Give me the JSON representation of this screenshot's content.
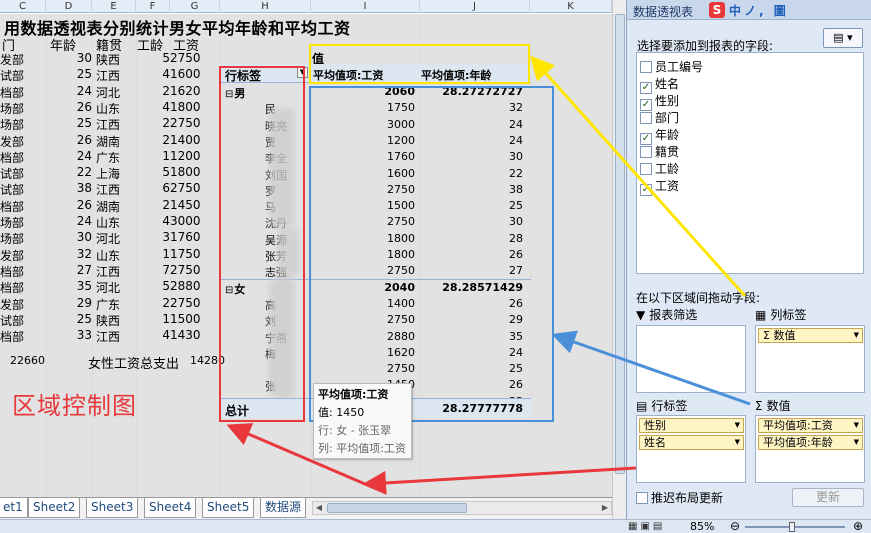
{
  "sheet": {
    "columns": [
      "C",
      "D",
      "E",
      "F",
      "G",
      "H",
      "I",
      "J",
      "K"
    ],
    "title": "用数据透视表分别统计男女平均年龄和平均工资",
    "headers": [
      "门",
      "年龄",
      "籍贯",
      "工龄",
      "工资"
    ],
    "rows": [
      [
        "发部",
        "30",
        "陕西",
        "5",
        "2750"
      ],
      [
        "试部",
        "25",
        "江西",
        "4",
        "1600"
      ],
      [
        "档部",
        "24",
        "河北",
        "2",
        "1620"
      ],
      [
        "场部",
        "26",
        "山东",
        "4",
        "1800"
      ],
      [
        "场部",
        "25",
        "江西",
        "2",
        "2750"
      ],
      [
        "发部",
        "26",
        "湖南",
        "2",
        "1400"
      ],
      [
        "档部",
        "24",
        "广东",
        "1",
        "1200"
      ],
      [
        "试部",
        "22",
        "上海",
        "5",
        "1800"
      ],
      [
        "试部",
        "38",
        "江西",
        "6",
        "2750"
      ],
      [
        "档部",
        "26",
        "湖南",
        "2",
        "1450"
      ],
      [
        "场部",
        "24",
        "山东",
        "4",
        "3000"
      ],
      [
        "场部",
        "30",
        "河北",
        "3",
        "1760"
      ],
      [
        "发部",
        "32",
        "山东",
        "1",
        "1750"
      ],
      [
        "档部",
        "27",
        "江西",
        "7",
        "2750"
      ],
      [
        "档部",
        "35",
        "河北",
        "5",
        "2880"
      ],
      [
        "发部",
        "29",
        "广东",
        "2",
        "2750"
      ],
      [
        "试部",
        "25",
        "陕西",
        "1",
        "1500"
      ],
      [
        "档部",
        "33",
        "江西",
        "4",
        "1430"
      ]
    ],
    "sum_value": "22660",
    "sum_label": "女性工资总支出",
    "sum_value2": "14280",
    "region_label": "区域控制图"
  },
  "pivot": {
    "values_header": "值",
    "row_label": "行标签",
    "col1_header": "平均值项:工资",
    "col2_header": "平均值项:年龄",
    "male": {
      "label": "男",
      "salary": "2060",
      "age": "28.27272727",
      "items": [
        {
          "name": "民",
          "salary": "1750",
          "age": "32"
        },
        {
          "name": "晓亮",
          "salary": "3000",
          "age": "24"
        },
        {
          "name": "贾",
          "salary": "1200",
          "age": "24"
        },
        {
          "name": "李全",
          "salary": "1760",
          "age": "30"
        },
        {
          "name": "刘国",
          "salary": "1600",
          "age": "22"
        },
        {
          "name": "罗",
          "salary": "2750",
          "age": "38"
        },
        {
          "name": "马",
          "salary": "1500",
          "age": "25"
        },
        {
          "name": "沈丹",
          "salary": "2750",
          "age": "30"
        },
        {
          "name": "吴源",
          "salary": "1800",
          "age": "28"
        },
        {
          "name": "张芳",
          "salary": "1800",
          "age": "26"
        },
        {
          "name": "志强",
          "salary": "2750",
          "age": "27"
        }
      ]
    },
    "female": {
      "label": "女",
      "salary": "2040",
      "age": "28.28571429",
      "items": [
        {
          "name": "高",
          "salary": "1400",
          "age": "26"
        },
        {
          "name": "刘",
          "salary": "2750",
          "age": "29"
        },
        {
          "name": "宁燕",
          "salary": "2880",
          "age": "35"
        },
        {
          "name": "梅",
          "salary": "1620",
          "age": "24"
        },
        {
          "name": "",
          "salary": "2750",
          "age": "25"
        },
        {
          "name": "张",
          "salary": "1450",
          "age": "26"
        },
        {
          "name": "周新",
          "salary": "",
          "age": "33"
        }
      ]
    },
    "total": {
      "label": "总计",
      "salary": "",
      "age": "28.27777778"
    }
  },
  "tooltip": {
    "title": "平均值项:工资",
    "value": "值: 1450",
    "row": "行: 女 - 张玉翠",
    "column": "列: 平均值项:工资"
  },
  "sheet_tabs": [
    "et1",
    "Sheet2",
    "Sheet3",
    "Sheet4",
    "Sheet5",
    "数据源"
  ],
  "panel": {
    "title": "数据透视表",
    "ime": "中ノ, 圖",
    "prompt": "选择要添加到报表的字段:",
    "fields": [
      {
        "label": "员工编号",
        "checked": false
      },
      {
        "label": "姓名",
        "checked": true
      },
      {
        "label": "性别",
        "checked": true
      },
      {
        "label": "部门",
        "checked": false
      },
      {
        "label": "年龄",
        "checked": true
      },
      {
        "label": "籍贯",
        "checked": false
      },
      {
        "label": "工龄",
        "checked": false
      },
      {
        "label": "工资",
        "checked": true
      }
    ],
    "drag_prompt": "在以下区域间拖动字段:",
    "zones": {
      "filter": "报表筛选",
      "column": "列标签",
      "row": "行标签",
      "values": "数值"
    },
    "column_chips": [
      "Σ 数值"
    ],
    "row_chips": [
      "性别",
      "姓名"
    ],
    "value_chips": [
      "平均值项:工资",
      "平均值项:年龄"
    ],
    "defer_label": "推迟布局更新",
    "update_label": "更新"
  },
  "status": {
    "zoom": "85%"
  },
  "colors": {
    "red": "#e8383b",
    "blue": "#4a90d9",
    "yellow": "#ffe600"
  }
}
